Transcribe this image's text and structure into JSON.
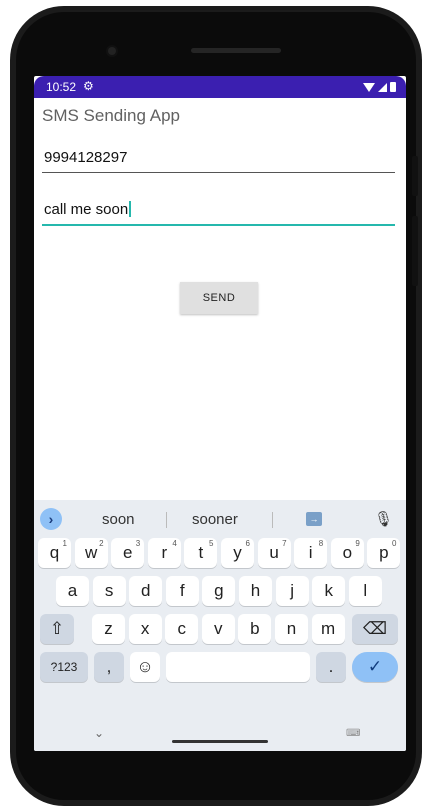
{
  "status_bar": {
    "time": "10:52",
    "settings_icon": "gear-icon",
    "wifi_icon": "wifi-icon",
    "signal_icon": "signal-icon",
    "battery_icon": "battery-icon",
    "color": "#3b1fb0"
  },
  "app": {
    "title": "SMS Sending App"
  },
  "phone_field": {
    "value": "9994128297"
  },
  "message_field": {
    "value": "call me soon",
    "underline_color": "#25b8ad"
  },
  "send_button": {
    "label": "SEND"
  },
  "keyboard": {
    "suggestions": [
      "soon",
      "sooner"
    ],
    "row1": [
      {
        "k": "q",
        "n": "1"
      },
      {
        "k": "w",
        "n": "2"
      },
      {
        "k": "e",
        "n": "3"
      },
      {
        "k": "r",
        "n": "4"
      },
      {
        "k": "t",
        "n": "5"
      },
      {
        "k": "y",
        "n": "6"
      },
      {
        "k": "u",
        "n": "7"
      },
      {
        "k": "i",
        "n": "8"
      },
      {
        "k": "o",
        "n": "9"
      },
      {
        "k": "p",
        "n": "0"
      }
    ],
    "row2": [
      "a",
      "s",
      "d",
      "f",
      "g",
      "h",
      "j",
      "k",
      "l"
    ],
    "row3": [
      "z",
      "x",
      "c",
      "v",
      "b",
      "n",
      "m"
    ],
    "symbols_label": "?123",
    "comma_label": ",",
    "period_label": ".",
    "shift_icon": "shift-icon",
    "backspace_icon": "backspace-icon",
    "emoji_icon": "emoji-icon",
    "enter_icon": "checkmark-icon",
    "mic_icon": "mic-icon",
    "accent_color": "#8fc1f6"
  }
}
